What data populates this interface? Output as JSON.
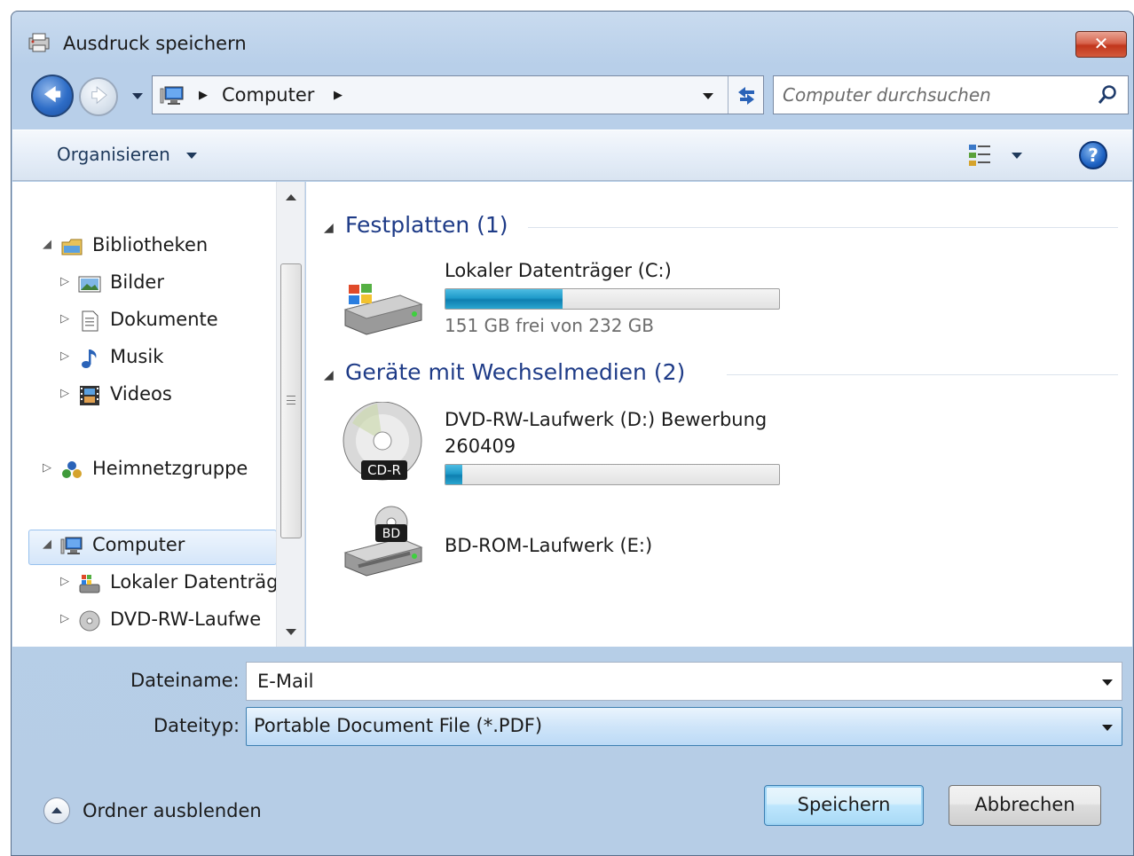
{
  "window": {
    "title": "Ausdruck speichern",
    "close_label": "✕"
  },
  "nav": {
    "address_location": "Computer",
    "search_placeholder": "Computer durchsuchen"
  },
  "toolbar": {
    "organize_label": "Organisieren",
    "help_label": "?"
  },
  "tree": {
    "libraries": "Bibliotheken",
    "pictures": "Bilder",
    "documents": "Dokumente",
    "music": "Musik",
    "videos": "Videos",
    "homegroup": "Heimnetzgruppe",
    "computer": "Computer",
    "local_disk": "Lokaler Datenträg",
    "dvd_drive": "DVD-RW-Laufwe"
  },
  "content": {
    "group_hdd": "Festplatten (1)",
    "group_removable": "Geräte mit Wechselmedien (2)",
    "drive_c": {
      "name": "Lokaler Datenträger (C:)",
      "free_text": "151 GB frei von 232 GB",
      "used_fraction": 0.35
    },
    "drive_d": {
      "name_line1": "DVD-RW-Laufwerk (D:) Bewerbung",
      "name_line2": "260409",
      "badge": "CD-R",
      "used_fraction": 0.05
    },
    "drive_e": {
      "name": "BD-ROM-Laufwerk (E:)",
      "badge": "BD"
    }
  },
  "form": {
    "filename_label": "Dateiname:",
    "filename_value": "E-Mail",
    "filetype_label": "Dateityp:",
    "filetype_value": "Portable Document File (*.PDF)"
  },
  "footer": {
    "hide_folders_label": "Ordner ausblenden",
    "save_label": "Speichern",
    "cancel_label": "Abbrechen"
  },
  "colors": {
    "accent": "#1e3b87",
    "progress": "#1f9ac9",
    "window_frame": "#b8cfe9"
  }
}
